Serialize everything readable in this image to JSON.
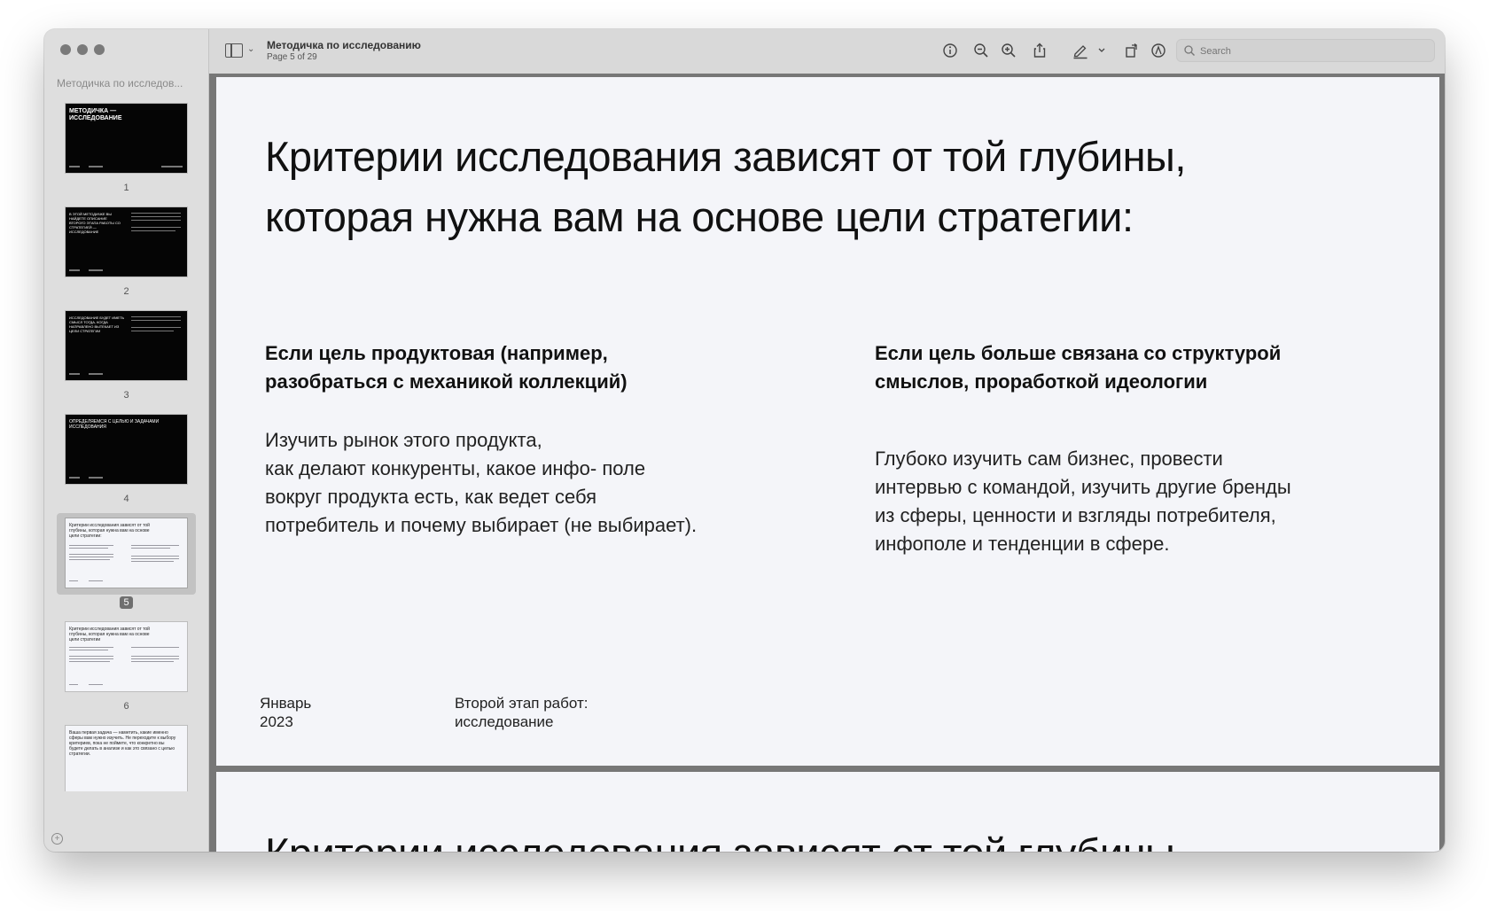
{
  "window": {
    "doc_title": "Методичка по исследованию",
    "page_indicator": "Page 5 of 29",
    "search_placeholder": "Search"
  },
  "sidebar": {
    "title": "Методичка по исследов...",
    "thumbnails": [
      {
        "page": "1",
        "text": "МЕТОДИЧКА — ИССЛЕДОВАНИЕ",
        "theme": "dark"
      },
      {
        "page": "2",
        "text": "В ЭТОЙ МЕТОДИЧКЕ ВЫ НАЙДЕТЕ ОПИСАНИЕ ВТОРОГО ЭТАПА РАБОТЫ СО СТРАТЕГИЕЙ — ИССЛЕДОВАНИЕ",
        "theme": "dark"
      },
      {
        "page": "3",
        "text": "ИССЛЕДОВАНИЕ БУДЕТ ИМЕТЬ СМЫСЛ ТОГДА, КОГДА НАПРАВЛЕНО ВЫТЕКАЕТ ИЗ ЦЕЛИ СТРАТЕГИИ",
        "theme": "dark"
      },
      {
        "page": "4",
        "text": "ОПРЕДЕЛЯЕМСЯ С ЦЕЛЬЮ И ЗАДАЧАМИ ИССЛЕДОВАНИЯ",
        "theme": "dark"
      },
      {
        "page": "5",
        "text": "Критерии исследования зависят от той глубины, которая нужна вам на основе цели стратегии:",
        "theme": "light"
      },
      {
        "page": "6",
        "text": "Критерии исследования зависят от той глубины, которая нужна вам на основе цели стратегии",
        "theme": "light"
      },
      {
        "page": "7",
        "text": "Ваша первая задача — наметить, какие именно сферы вам нужно изучить. Не переходите к выбору критериев, пока не поймете, что конкретно вы будете делать в анализе и как это связано с целью стратегии.",
        "theme": "light"
      }
    ]
  },
  "slide": {
    "heading_line1": "Критерии исследования зависят от той глубины,",
    "heading_line2": "которая нужна вам на основе цели стратегии:",
    "left_subhead_line1": "Если цель продуктовая (например,",
    "left_subhead_line2": "разобраться с механикой коллекций)",
    "left_body": [
      "Изучить рынок этого продукта,",
      "как делают конкуренты, какое инфо- поле",
      "вокруг продукта есть, как ведет себя",
      "потребитель и почему выбирает (не выбирает)."
    ],
    "right_subhead_line1": "Если цель больше связана со структурой",
    "right_subhead_line2": "смыслов, проработкой идеологии",
    "right_body": [
      "Глубоко изучить сам бизнес, провести",
      "интервью с командой, изучить другие бренды",
      "из сферы, ценности и взгляды потребителя,",
      "инфополе и тенденции в сфере."
    ],
    "footer_date_line1": "Январь",
    "footer_date_line2": "2023",
    "footer_stage_line1": "Второй этап работ:",
    "footer_stage_line2": "исследование"
  },
  "next_slide": {
    "heading_line1": "Критерии исследования зависят от той глубины,"
  },
  "colors": {
    "page_bg": "#f4f5f9",
    "sidebar_bg": "#dedede",
    "toolbar_bg": "#d9d9d9",
    "dark_thumb": "#050505"
  }
}
